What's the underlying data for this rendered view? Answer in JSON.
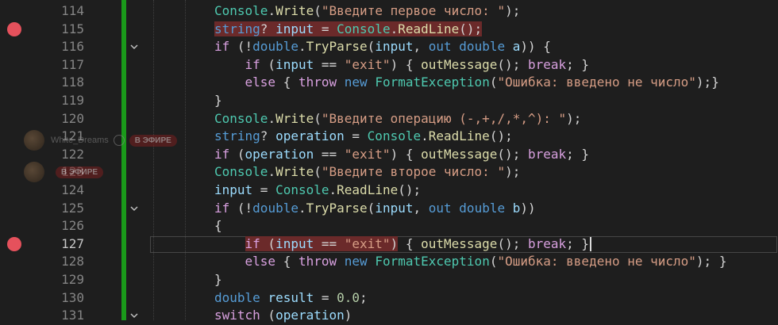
{
  "editor": {
    "line_numbers": [
      "114",
      "115",
      "116",
      "117",
      "118",
      "119",
      "120",
      "121",
      "122",
      "123",
      "124",
      "125",
      "126",
      "127",
      "128",
      "129",
      "130",
      "131"
    ],
    "active_line": "127",
    "breakpoint_lines": [
      "115",
      "127"
    ],
    "fold_lines": [
      "116",
      "125",
      "131"
    ],
    "lines": [
      [
        [
          "c-cls",
          "Console"
        ],
        [
          "c-pl",
          "."
        ],
        [
          "c-mth",
          "Write"
        ],
        [
          "c-pl",
          "("
        ],
        [
          "c-str",
          "\"Введите первое число: \""
        ],
        [
          "c-pl",
          ");"
        ]
      ],
      [
        [
          "c-kw",
          "string"
        ],
        [
          "c-pl",
          "? "
        ],
        [
          "c-var",
          "input"
        ],
        [
          "c-pl",
          " = "
        ],
        [
          "c-cls",
          "Console"
        ],
        [
          "c-pl",
          "."
        ],
        [
          "c-mth",
          "ReadLine"
        ],
        [
          "c-pl",
          "();"
        ]
      ],
      [
        [
          "c-ctl",
          "if"
        ],
        [
          "c-pl",
          " (!"
        ],
        [
          "c-kw",
          "double"
        ],
        [
          "c-pl",
          "."
        ],
        [
          "c-mth",
          "TryParse"
        ],
        [
          "c-pl",
          "("
        ],
        [
          "c-var",
          "input"
        ],
        [
          "c-pl",
          ", "
        ],
        [
          "c-kw",
          "out"
        ],
        [
          "c-pl",
          " "
        ],
        [
          "c-kw",
          "double"
        ],
        [
          "c-pl",
          " "
        ],
        [
          "c-var",
          "a"
        ],
        [
          "c-pl",
          ")) {"
        ]
      ],
      [
        [
          "c-pl",
          "    "
        ],
        [
          "c-ctl",
          "if"
        ],
        [
          "c-pl",
          " ("
        ],
        [
          "c-var",
          "input"
        ],
        [
          "c-pl",
          " == "
        ],
        [
          "c-str",
          "\"exit\""
        ],
        [
          "c-pl",
          ") { "
        ],
        [
          "c-mth",
          "outMessage"
        ],
        [
          "c-pl",
          "(); "
        ],
        [
          "c-ctl",
          "break"
        ],
        [
          "c-pl",
          "; }"
        ]
      ],
      [
        [
          "c-pl",
          "    "
        ],
        [
          "c-ctl",
          "else"
        ],
        [
          "c-pl",
          " { "
        ],
        [
          "c-ctl",
          "throw"
        ],
        [
          "c-pl",
          " "
        ],
        [
          "c-kw",
          "new"
        ],
        [
          "c-pl",
          " "
        ],
        [
          "c-cls",
          "FormatException"
        ],
        [
          "c-pl",
          "("
        ],
        [
          "c-str",
          "\"Ошибка: введено не число\""
        ],
        [
          "c-pl",
          ");}"
        ]
      ],
      [
        [
          "c-pl",
          "}"
        ]
      ],
      [
        [
          "c-cls",
          "Console"
        ],
        [
          "c-pl",
          "."
        ],
        [
          "c-mth",
          "Write"
        ],
        [
          "c-pl",
          "("
        ],
        [
          "c-str",
          "\"Введите операцию (-,+,/,*,^): \""
        ],
        [
          "c-pl",
          ");"
        ]
      ],
      [
        [
          "c-kw",
          "string"
        ],
        [
          "c-pl",
          "? "
        ],
        [
          "c-var",
          "operation"
        ],
        [
          "c-pl",
          " = "
        ],
        [
          "c-cls",
          "Console"
        ],
        [
          "c-pl",
          "."
        ],
        [
          "c-mth",
          "ReadLine"
        ],
        [
          "c-pl",
          "();"
        ]
      ],
      [
        [
          "c-ctl",
          "if"
        ],
        [
          "c-pl",
          " ("
        ],
        [
          "c-var",
          "operation"
        ],
        [
          "c-pl",
          " == "
        ],
        [
          "c-str",
          "\"exit\""
        ],
        [
          "c-pl",
          ") { "
        ],
        [
          "c-mth",
          "outMessage"
        ],
        [
          "c-pl",
          "(); "
        ],
        [
          "c-ctl",
          "break"
        ],
        [
          "c-pl",
          "; }"
        ]
      ],
      [
        [
          "c-cls",
          "Console"
        ],
        [
          "c-pl",
          "."
        ],
        [
          "c-mth",
          "Write"
        ],
        [
          "c-pl",
          "("
        ],
        [
          "c-str",
          "\"Введите второе число: \""
        ],
        [
          "c-pl",
          ");"
        ]
      ],
      [
        [
          "c-var",
          "input"
        ],
        [
          "c-pl",
          " = "
        ],
        [
          "c-cls",
          "Console"
        ],
        [
          "c-pl",
          "."
        ],
        [
          "c-mth",
          "ReadLine"
        ],
        [
          "c-pl",
          "();"
        ]
      ],
      [
        [
          "c-ctl",
          "if"
        ],
        [
          "c-pl",
          " (!"
        ],
        [
          "c-kw",
          "double"
        ],
        [
          "c-pl",
          "."
        ],
        [
          "c-mth",
          "TryParse"
        ],
        [
          "c-pl",
          "("
        ],
        [
          "c-var",
          "input"
        ],
        [
          "c-pl",
          ", "
        ],
        [
          "c-kw",
          "out"
        ],
        [
          "c-pl",
          " "
        ],
        [
          "c-kw",
          "double"
        ],
        [
          "c-pl",
          " "
        ],
        [
          "c-var",
          "b"
        ],
        [
          "c-pl",
          "))"
        ]
      ],
      [
        [
          "c-pl",
          "{"
        ]
      ],
      [
        [
          "c-pl",
          "    "
        ],
        [
          "c-ctl",
          "if"
        ],
        [
          "c-pl",
          " ("
        ],
        [
          "c-var",
          "input"
        ],
        [
          "c-pl",
          " == "
        ],
        [
          "c-str",
          "\"exit\""
        ],
        [
          "c-pl",
          ") { "
        ],
        [
          "c-mth",
          "outMessage"
        ],
        [
          "c-pl",
          "(); "
        ],
        [
          "c-ctl",
          "break"
        ],
        [
          "c-pl",
          "; }"
        ]
      ],
      [
        [
          "c-pl",
          "    "
        ],
        [
          "c-ctl",
          "else"
        ],
        [
          "c-pl",
          " { "
        ],
        [
          "c-ctl",
          "throw"
        ],
        [
          "c-pl",
          " "
        ],
        [
          "c-kw",
          "new"
        ],
        [
          "c-pl",
          " "
        ],
        [
          "c-cls",
          "FormatException"
        ],
        [
          "c-pl",
          "("
        ],
        [
          "c-str",
          "\"Ошибка: введено не число\""
        ],
        [
          "c-pl",
          "); }"
        ]
      ],
      [
        [
          "c-pl",
          "}"
        ]
      ],
      [
        [
          "c-kw",
          "double"
        ],
        [
          "c-pl",
          " "
        ],
        [
          "c-var",
          "result"
        ],
        [
          "c-pl",
          " = "
        ],
        [
          "c-num",
          "0.0"
        ],
        [
          "c-pl",
          ";"
        ]
      ],
      [
        [
          "c-ctl",
          "switch"
        ],
        [
          "c-pl",
          " ("
        ],
        [
          "c-var",
          "operation"
        ],
        [
          "c-pl",
          ")"
        ]
      ]
    ]
  },
  "stream_overlays": [
    {
      "name": "White_Dreams",
      "badge": "В ЭФИРЕ"
    },
    {
      "name": "",
      "badge": "В ЭФИРЕ"
    }
  ],
  "colors": {
    "background": "#1e1e1e",
    "breakpoint": "#e5515c",
    "breakpoint_highlight": "#6b2a2a",
    "change_bar": "#1a9a1a"
  }
}
